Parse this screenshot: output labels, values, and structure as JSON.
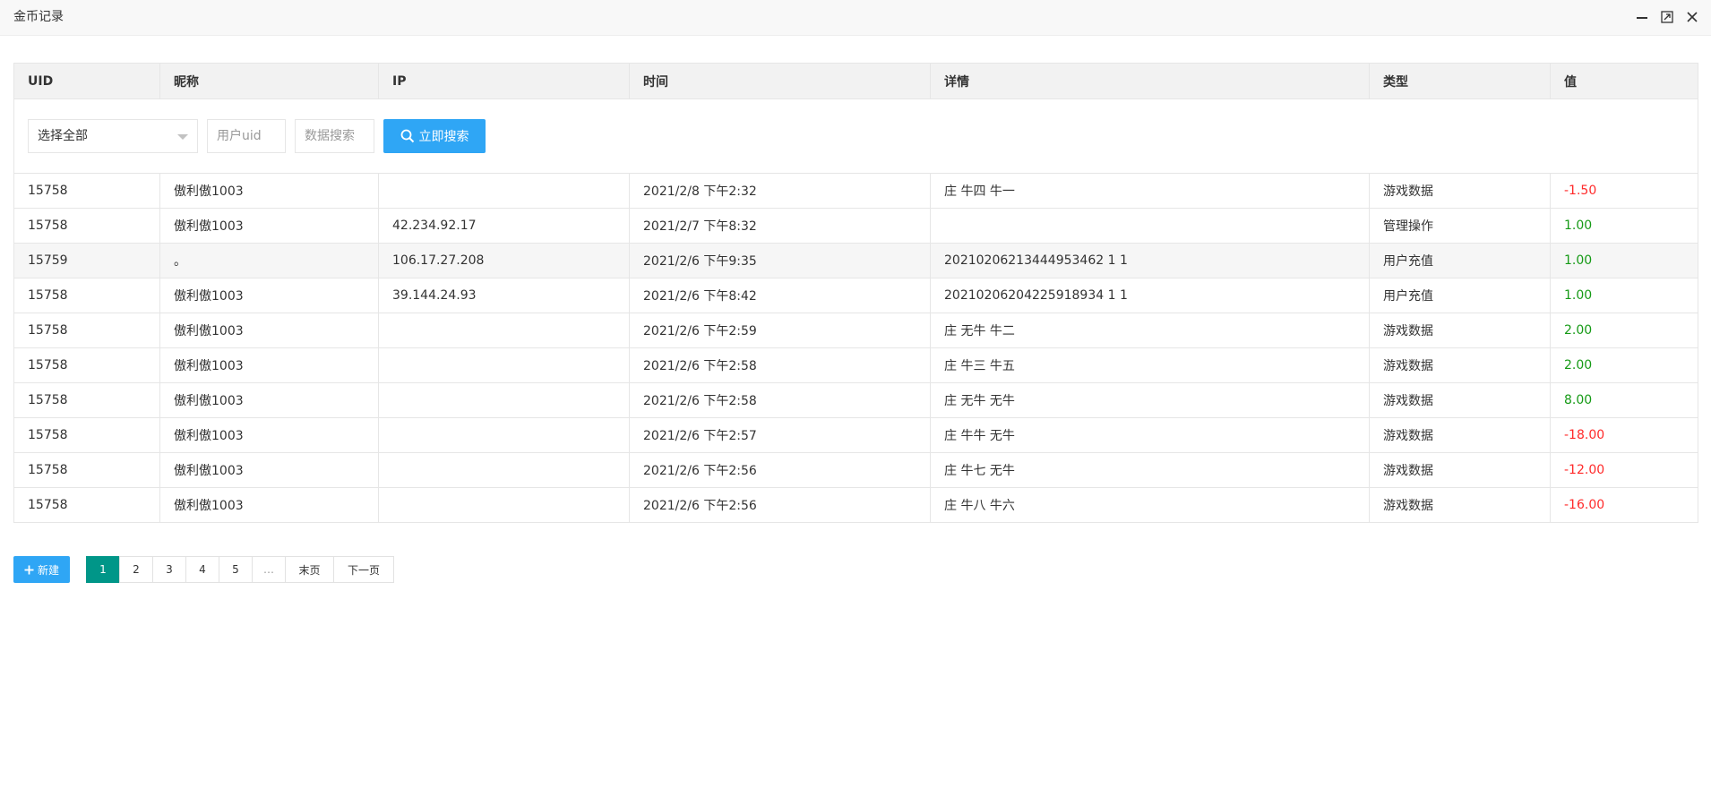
{
  "window": {
    "title": "金币记录"
  },
  "table": {
    "columns": [
      "UID",
      "昵称",
      "IP",
      "时间",
      "详情",
      "类型",
      "值"
    ],
    "filter": {
      "select_value": "选择全部",
      "uid_placeholder": "用户uid",
      "search_placeholder": "数据搜索",
      "search_button": "立即搜索"
    },
    "rows": [
      {
        "uid": "15758",
        "nick": "傲利傲1003",
        "ip": "",
        "time": "2021/2/8 下午2:32",
        "detail": "庄 牛四 牛一",
        "type": "游戏数据",
        "value": "-1.50"
      },
      {
        "uid": "15758",
        "nick": "傲利傲1003",
        "ip": "42.234.92.17",
        "time": "2021/2/7 下午8:32",
        "detail": "",
        "type": "管理操作",
        "value": "1.00"
      },
      {
        "uid": "15759",
        "nick": "。",
        "ip": "106.17.27.208",
        "time": "2021/2/6 下午9:35",
        "detail": "20210206213444953462 1 1",
        "type": "用户充值",
        "value": "1.00"
      },
      {
        "uid": "15758",
        "nick": "傲利傲1003",
        "ip": "39.144.24.93",
        "time": "2021/2/6 下午8:42",
        "detail": "20210206204225918934 1 1",
        "type": "用户充值",
        "value": "1.00"
      },
      {
        "uid": "15758",
        "nick": "傲利傲1003",
        "ip": "",
        "time": "2021/2/6 下午2:59",
        "detail": "庄 无牛 牛二",
        "type": "游戏数据",
        "value": "2.00"
      },
      {
        "uid": "15758",
        "nick": "傲利傲1003",
        "ip": "",
        "time": "2021/2/6 下午2:58",
        "detail": "庄 牛三 牛五",
        "type": "游戏数据",
        "value": "2.00"
      },
      {
        "uid": "15758",
        "nick": "傲利傲1003",
        "ip": "",
        "time": "2021/2/6 下午2:58",
        "detail": "庄 无牛 无牛",
        "type": "游戏数据",
        "value": "8.00"
      },
      {
        "uid": "15758",
        "nick": "傲利傲1003",
        "ip": "",
        "time": "2021/2/6 下午2:57",
        "detail": "庄 牛牛 无牛",
        "type": "游戏数据",
        "value": "-18.00"
      },
      {
        "uid": "15758",
        "nick": "傲利傲1003",
        "ip": "",
        "time": "2021/2/6 下午2:56",
        "detail": "庄 牛七 无牛",
        "type": "游戏数据",
        "value": "-12.00"
      },
      {
        "uid": "15758",
        "nick": "傲利傲1003",
        "ip": "",
        "time": "2021/2/6 下午2:56",
        "detail": "庄 牛八 牛六",
        "type": "游戏数据",
        "value": "-16.00"
      }
    ]
  },
  "actions": {
    "add_button": "新建"
  },
  "pagination": {
    "pages": [
      "1",
      "2",
      "3",
      "4",
      "5"
    ],
    "current": "1",
    "ellipsis": "…",
    "last_label": "末页",
    "next_label": "下一页"
  },
  "colors": {
    "accent_blue": "#2fa6f5",
    "pager_active": "#009688",
    "negative": "#ff2a2a",
    "positive": "#169a16"
  }
}
